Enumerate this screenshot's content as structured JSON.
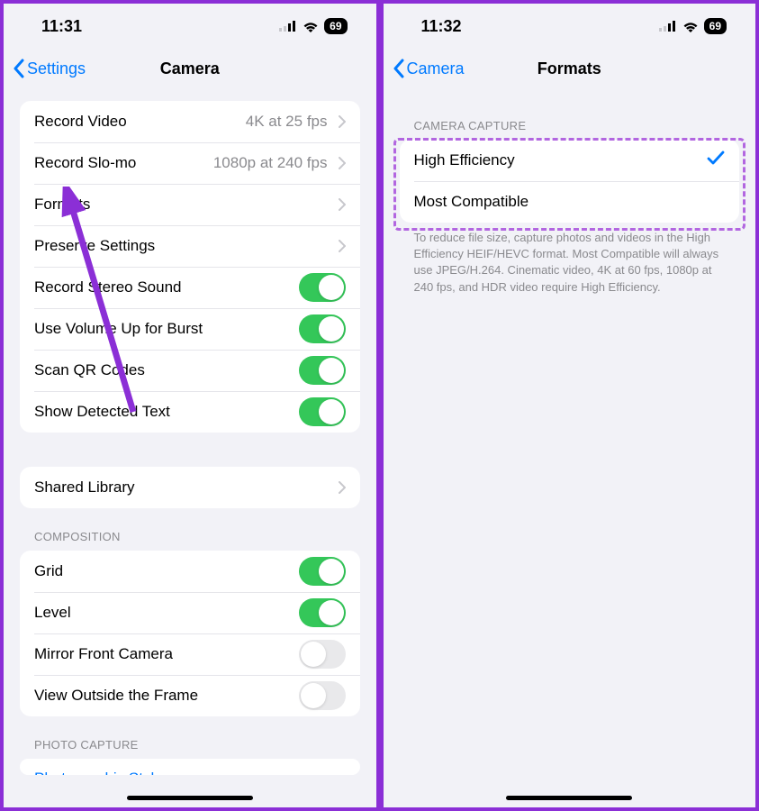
{
  "left": {
    "status": {
      "time": "11:31",
      "battery": "69"
    },
    "nav": {
      "back": "Settings",
      "title": "Camera"
    },
    "rows": {
      "record_video": {
        "label": "Record Video",
        "detail": "4K at 25 fps"
      },
      "record_slomo": {
        "label": "Record Slo-mo",
        "detail": "1080p at 240 fps"
      },
      "formats": {
        "label": "Formats"
      },
      "preserve": {
        "label": "Preserve Settings"
      },
      "stereo": {
        "label": "Record Stereo Sound"
      },
      "volume_burst": {
        "label": "Use Volume Up for Burst"
      },
      "scan_qr": {
        "label": "Scan QR Codes"
      },
      "detected_text": {
        "label": "Show Detected Text"
      },
      "shared_library": {
        "label": "Shared Library"
      },
      "grid": {
        "label": "Grid"
      },
      "level": {
        "label": "Level"
      },
      "mirror_front": {
        "label": "Mirror Front Camera"
      },
      "outside_frame": {
        "label": "View Outside the Frame"
      },
      "photographic_styles": {
        "label": "Photographic Styles"
      }
    },
    "sections": {
      "composition": "COMPOSITION",
      "photo_capture": "PHOTO CAPTURE"
    }
  },
  "right": {
    "status": {
      "time": "11:32",
      "battery": "69"
    },
    "nav": {
      "back": "Camera",
      "title": "Formats"
    },
    "sections": {
      "camera_capture": "CAMERA CAPTURE"
    },
    "rows": {
      "high_efficiency": {
        "label": "High Efficiency"
      },
      "most_compatible": {
        "label": "Most Compatible"
      }
    },
    "footer": "To reduce file size, capture photos and videos in the High Efficiency HEIF/HEVC format. Most Compatible will always use JPEG/H.264. Cinematic video, 4K at 60 fps, 1080p at 240 fps, and HDR video require High Efficiency."
  }
}
